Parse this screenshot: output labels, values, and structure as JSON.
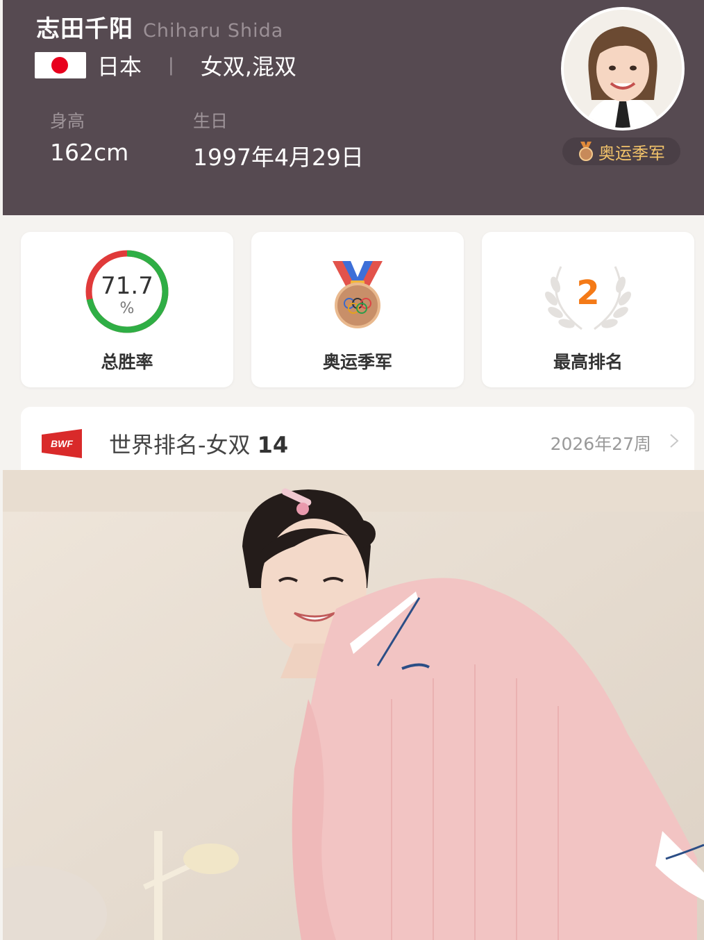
{
  "player": {
    "name_cn": "志田千阳",
    "name_en": "Chiharu Shida",
    "country": "日本",
    "divider": "|",
    "events": "女双,混双",
    "height_label": "身高",
    "height_value": "162cm",
    "birthday_label": "生日",
    "birthday_value": "1997年4月29日",
    "badge": "奥运季军"
  },
  "stats": {
    "win_rate_value": "71.7",
    "win_rate_unit": "%",
    "win_rate_fraction": 0.717,
    "win_rate_label": "总胜率",
    "olympic_label": "奥运季军",
    "best_rank_value": "2",
    "best_rank_label": "最高排名"
  },
  "ranking": {
    "logo": "BWF",
    "title": "世界排名-女双",
    "value": "14",
    "week": "2026年27周"
  },
  "colors": {
    "header_bg": "#564a51",
    "ring_green": "#2fae45",
    "ring_red": "#e03a3a",
    "accent_orange": "#f47a17",
    "badge_gold": "#f2c36a"
  },
  "icons": {
    "flag": "japan-flag-icon",
    "medal": "bronze-medal-icon",
    "laurel": "laurel-wreath-icon",
    "bwf": "bwf-logo-icon",
    "chevron": "chevron-right-icon"
  }
}
